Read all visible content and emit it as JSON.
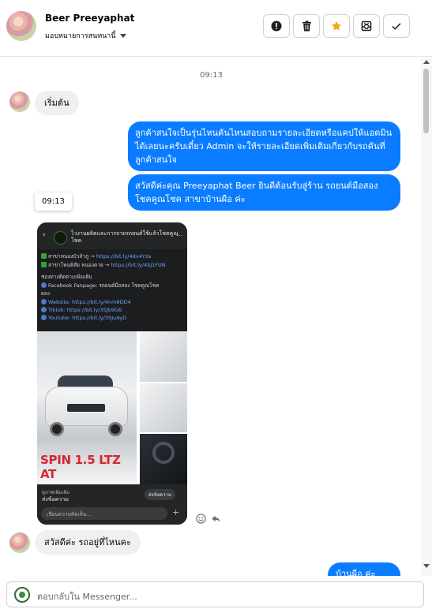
{
  "header": {
    "contact_name": "Beer Preeyaphat",
    "assign_label": "มอบหมายการสนทนานี้",
    "actions": [
      "report-icon",
      "trash-icon",
      "star-icon",
      "mark-unread-icon",
      "check-icon"
    ]
  },
  "thread": {
    "time_stamp": "09:13",
    "messages": [
      {
        "from": "customer",
        "text": "เริ่มต้น"
      },
      {
        "from": "page",
        "text": "ลูกค้าสนใจเป็นรุ่นไหนคันไหนสอบถามรายละเอียดหรือแคปให้แอดมินได้เลยนะครับเดี๋ยว Admin จะให้รายละเอียดเพิ่มเติมเกี่ยวกับรถคันที่ลูกค้าสนใจ"
      },
      {
        "from": "page",
        "text": "สวัสดีค่ะคุณ Preeyaphat Beer ยินดีต้อนรับสู่ร้าน รถยนต์มือสองโชคคูณโชค สาขาบ้านผือ ค่ะ"
      },
      {
        "from": "customer",
        "text": "สวัสดีค่ะ รถอยู่ที่ไหนคะ"
      },
      {
        "from": "page",
        "text": "บ้านผือ ค่ะ"
      }
    ],
    "tooltip_time": "09:13",
    "shared_image": {
      "page_title": "ไวงานผลิตและการจายรถยนต์ใช้แล้วโชคคูณโชค",
      "line1_prefix": "สาขาหนองบัวลำภู →",
      "line1_link": "https://bit.ly/4dv4Yza",
      "line2_prefix": "สาขาโพนพิสัย หนองคาย →",
      "line2_link": "https://bit.ly/4SJ1FUN",
      "follow_label": "ช่องทางติดตามเพิ่มเติม",
      "facebook": "Facebook Fanpage: รถยนต์มือสอง โชคคูณโชค",
      "facebook_cont": "ผลง",
      "website": "Website: https://bit.ly/4nm8DD4",
      "tiktok": "Tiktok: https://bit.ly/3SJb9G6",
      "youtube": "Youtube: https://bit.ly/3SJuAyD",
      "car_caption": "SPIN 1.5 LTZ AT",
      "footer_top": "ดูภาพเพิ่มเติม",
      "footer_label": "ส่งข้อความ",
      "footer_button": "ส่งข้อความ",
      "footer_input": "เขียนความคิดเห็น..."
    }
  },
  "composer": {
    "placeholder": "ตอบกลับใน Messenger..."
  },
  "colors": {
    "outgoing": "#0a7cff",
    "incoming": "#f0f0f0",
    "star": "#f5a623"
  }
}
